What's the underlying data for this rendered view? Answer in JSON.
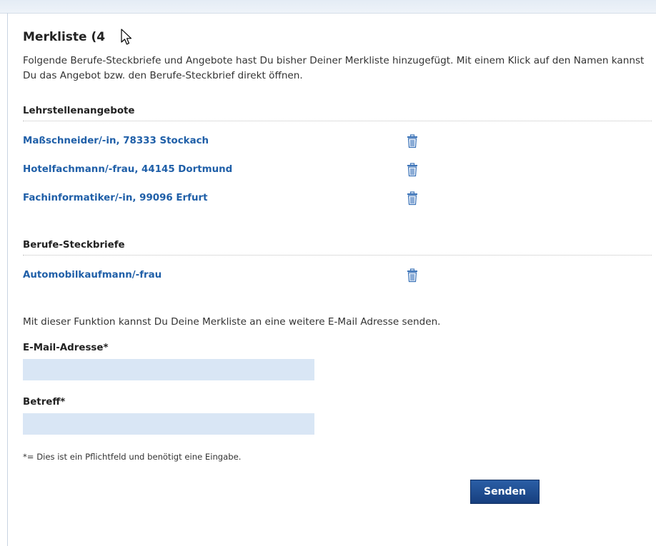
{
  "page": {
    "title": "Merkliste (4",
    "intro": "Folgende Berufe-Steckbriefe und Angebote hast Du bisher Deiner Merkliste hinzugefügt. Mit einem Klick auf den Namen kannst Du das Angebot bzw. den Berufe-Steckbrief direkt öffnen."
  },
  "lehrstellen": {
    "heading": "Lehrstellenangebote",
    "items": [
      {
        "label": "Maßschneider/-in, 78333 Stockach"
      },
      {
        "label": "Hotelfachmann/-frau, 44145 Dortmund"
      },
      {
        "label": "Fachinformatiker/-in, 99096 Erfurt"
      }
    ]
  },
  "steckbriefe": {
    "heading": "Berufe-Steckbriefe",
    "items": [
      {
        "label": "Automobilkaufmann/-frau"
      }
    ]
  },
  "form": {
    "description": "Mit dieser Funktion kannst Du Deine Merkliste an eine weitere E-Mail Adresse senden.",
    "email_label": "E-Mail-Adresse*",
    "email_value": "",
    "subject_label": "Betreff*",
    "subject_value": "",
    "required_note": "*= Dies ist ein Pflichtfeld und benötigt eine Eingabe.",
    "submit_label": "Senden"
  },
  "colors": {
    "link": "#1f5fa8",
    "input_bg": "#d9e6f5",
    "button_bg": "#1f4f94"
  }
}
